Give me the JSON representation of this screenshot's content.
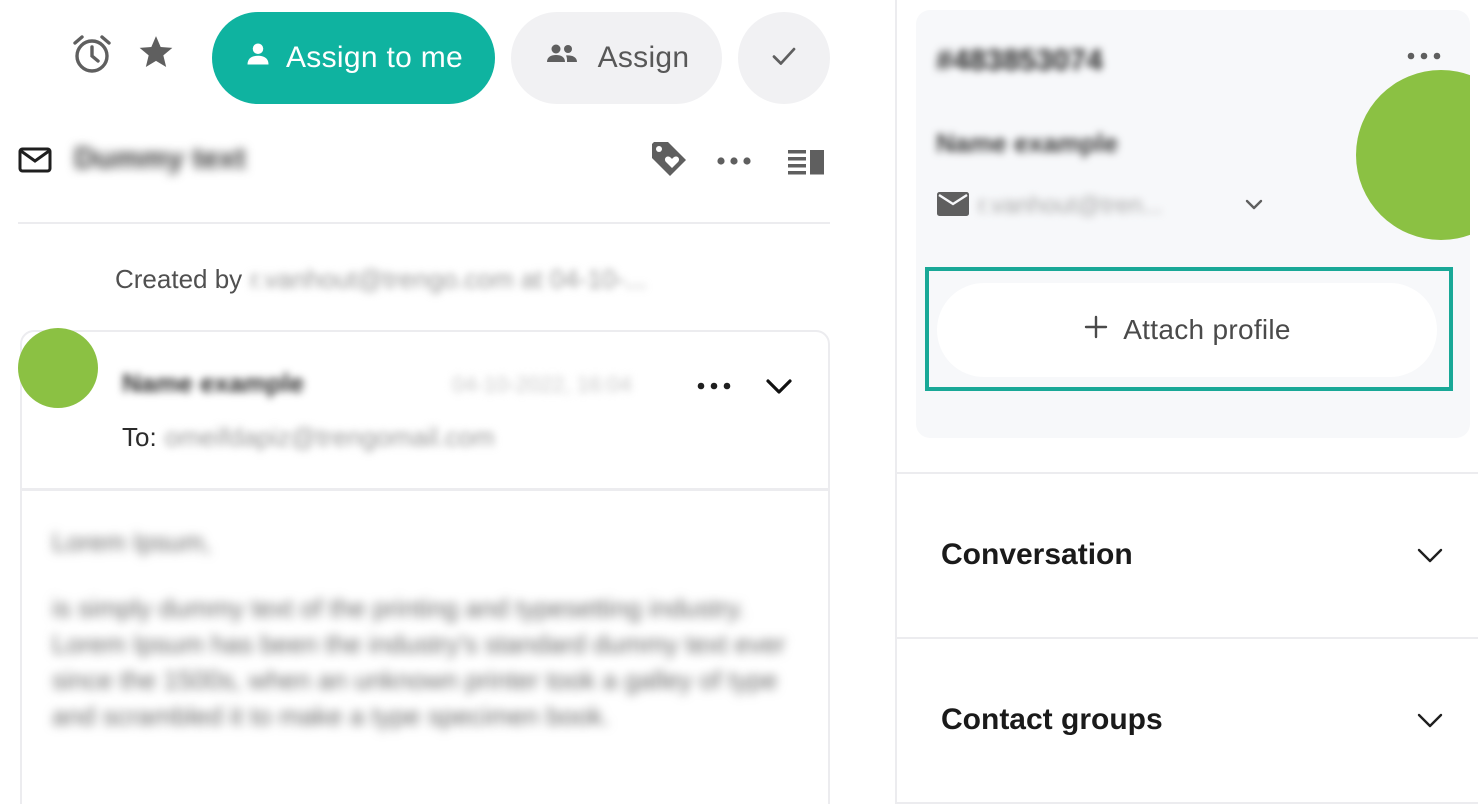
{
  "toolbar": {
    "assign_to_me_label": "Assign to me",
    "assign_label": "Assign",
    "accent_color": "#0fb3a0"
  },
  "ticket": {
    "subject": "Dummy text",
    "created_by_prefix": "Created by",
    "created_by_value": "r.vanhout@trengo.com at 04-10-..."
  },
  "message": {
    "sender": "Name example",
    "date": "04-10-2022, 16:04",
    "to_label": "To:",
    "to_value": "omeifdapiz@trengomail.com",
    "body": [
      "Lorem Ipsum,",
      "is simply dummy text of the printing and typesetting industry. Lorem Ipsum has been the industry's standard dummy text ever since the 1500s, when an unknown printer took a galley of type and scrambled it to make a type specimen book."
    ],
    "avatar_color": "#8bc143"
  },
  "contact": {
    "id": "#483853074",
    "name": "Name example",
    "email": "r.vanhout@tren...",
    "avatar_color": "#8bc143",
    "attach_label": "Attach profile",
    "highlight_color": "#19a897"
  },
  "sections": [
    {
      "title": "Conversation"
    },
    {
      "title": "Contact groups"
    }
  ]
}
